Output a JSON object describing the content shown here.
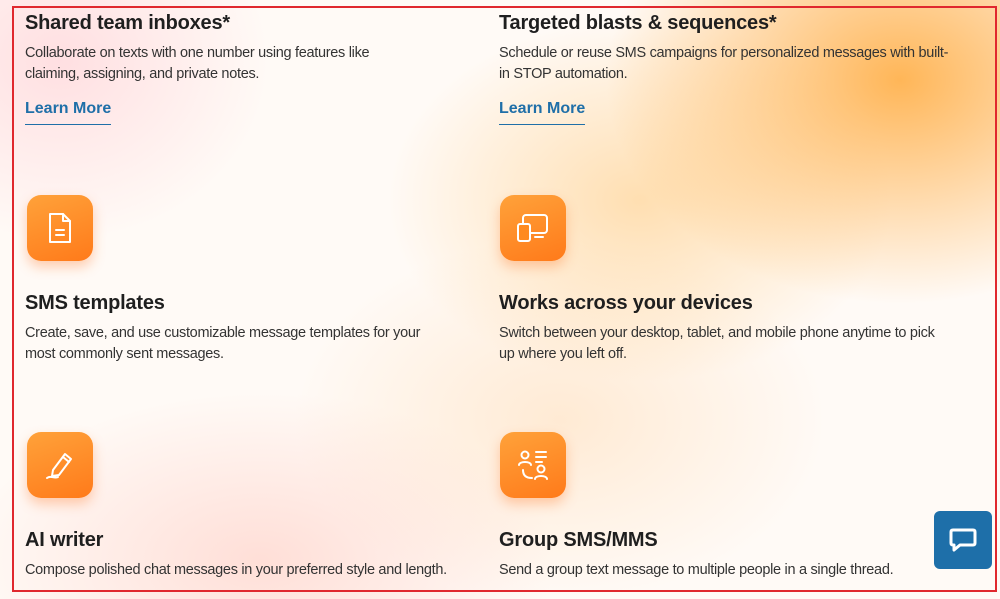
{
  "features": [
    {
      "title": "Shared team inboxes*",
      "description": "Collaborate on texts with one number using features like claiming, assigning, and private notes.",
      "link": "Learn More"
    },
    {
      "title": "Targeted blasts & sequences*",
      "description": "Schedule or reuse SMS campaigns for personalized messages with built-in STOP automation.",
      "link": "Learn More"
    },
    {
      "title": "SMS templates",
      "description": "Create, save, and use customizable message templates for your most commonly sent messages.",
      "icon": "document-icon"
    },
    {
      "title": "Works across your devices",
      "description": "Switch between your desktop, tablet, and mobile phone anytime to pick up where you left off.",
      "icon": "devices-icon"
    },
    {
      "title": "AI writer",
      "description": "Compose polished chat messages in your preferred style and length.",
      "icon": "pen-icon"
    },
    {
      "title": "Group SMS/MMS",
      "description": "Send a group text message to multiple people in a single thread.",
      "icon": "group-icon"
    }
  ],
  "colors": {
    "accent_orange": "#ff8a1f",
    "link_blue": "#1f6fa8",
    "chat_button": "#1e6fa9",
    "frame_border": "#e0282e"
  },
  "chat_widget": {
    "icon": "chat-bubble-icon"
  }
}
